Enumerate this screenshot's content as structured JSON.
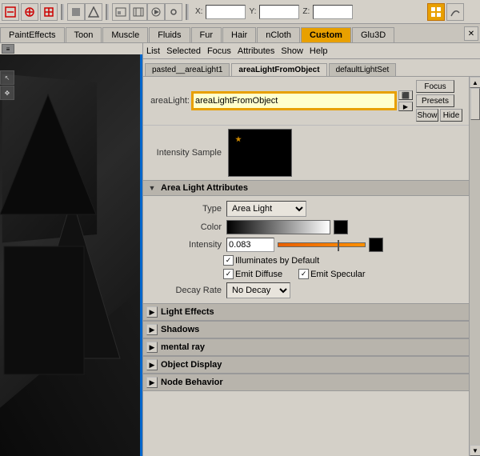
{
  "toolbar": {
    "coord_x_label": "X:",
    "coord_y_label": "Y:",
    "coord_z_label": "Z:",
    "coord_x_value": "",
    "coord_y_value": "",
    "coord_z_value": ""
  },
  "tabs": {
    "items": [
      {
        "label": "PaintEffects",
        "active": false
      },
      {
        "label": "Toon",
        "active": false
      },
      {
        "label": "Muscle",
        "active": false
      },
      {
        "label": "Fluids",
        "active": false
      },
      {
        "label": "Fur",
        "active": false
      },
      {
        "label": "Hair",
        "active": false
      },
      {
        "label": "nCloth",
        "active": false
      },
      {
        "label": "Custom",
        "active": true
      },
      {
        "label": "Glu3D",
        "active": false
      }
    ]
  },
  "attr_editor": {
    "menu": {
      "list": "List",
      "selected": "Selected",
      "focus": "Focus",
      "attributes": "Attributes",
      "show": "Show",
      "help": "Help"
    },
    "tabs": [
      {
        "label": "pasted__areaLight1",
        "active": false
      },
      {
        "label": "areaLightFromObject",
        "active": true
      },
      {
        "label": "defaultLightSet",
        "active": false
      }
    ],
    "light_name_label": "areaLight:",
    "light_name_value": "areaLightFromObject",
    "focus_btn": "Focus",
    "presets_btn": "Presets",
    "show_btn": "Show",
    "hide_btn": "Hide",
    "intensity_sample_label": "Intensity Sample",
    "section_area_light": "Area Light Attributes",
    "type_label": "Type",
    "type_value": "Area Light",
    "color_label": "Color",
    "intensity_label": "Intensity",
    "intensity_value": "0.083",
    "illuminates_default": "Illuminates by Default",
    "emit_diffuse": "Emit Diffuse",
    "emit_specular": "Emit Specular",
    "decay_rate_label": "Decay Rate",
    "decay_rate_value": "No Decay",
    "sections": [
      {
        "label": "Light Effects"
      },
      {
        "label": "Shadows"
      },
      {
        "label": "mental ray"
      },
      {
        "label": "Object Display"
      },
      {
        "label": "Node Behavior"
      }
    ]
  }
}
